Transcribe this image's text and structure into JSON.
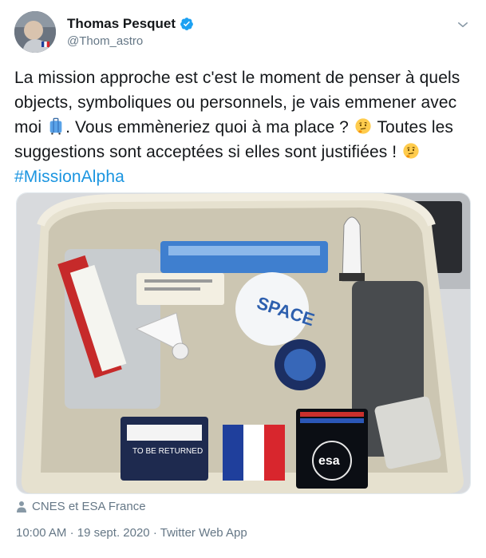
{
  "author": {
    "name": "Thomas Pesquet",
    "handle": "@Thom_astro",
    "verified": true
  },
  "tweet": {
    "text_part1": "La mission approche est c'est le moment de penser à quels objects, symboliques ou personnels, je vais emmener avec moi",
    "text_part2": ". Vous emmèneriez quoi à ma place ?",
    "text_part3": "Toutes les suggestions sont acceptées si elles sont justifiées !",
    "hashtag": "#MissionAlpha",
    "emojis": [
      "luggage-emoji",
      "thinking-face-emoji",
      "thinking-face-emoji"
    ]
  },
  "photo": {
    "description_icons": [
      "open-bag",
      "ziplock-bags",
      "shuttlecock",
      "flag-patches",
      "esa-patch",
      "space-patch",
      "rocket-toy"
    ],
    "labels": {
      "to_be_returned": "TO BE RETURNED",
      "esa": "esa",
      "space_sticker": "SPACE"
    }
  },
  "location": {
    "icon": "person-icon",
    "text": "CNES et ESA France"
  },
  "meta": {
    "time": "10:00 AM",
    "sep": "·",
    "date": "19 sept. 2020",
    "source": "Twitter Web App"
  },
  "colors": {
    "text": "#14171a",
    "secondary": "#657786",
    "link": "#1b95e0",
    "verified": "#1da1f2"
  }
}
